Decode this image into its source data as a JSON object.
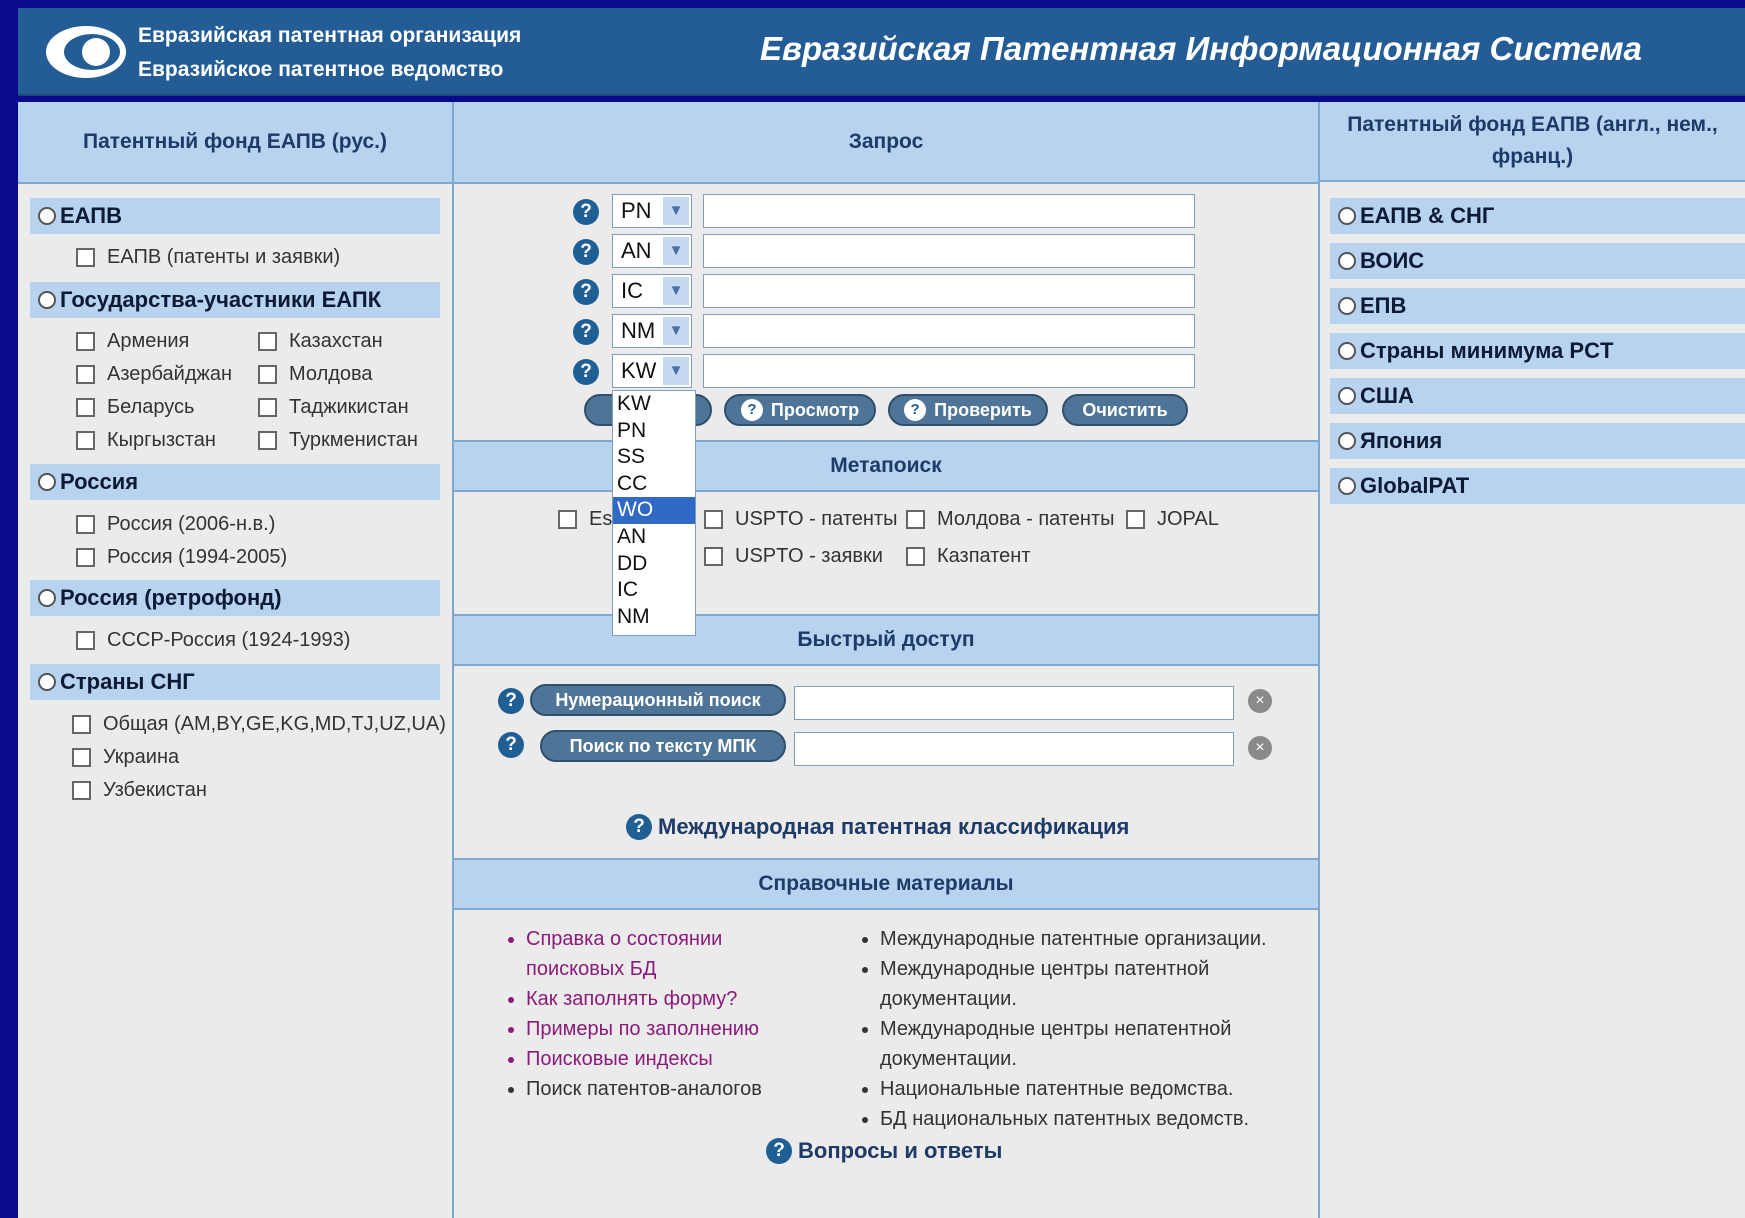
{
  "header": {
    "org_line1": "Евразийская патентная организация",
    "org_line2": "Евразийское патентное ведомство",
    "system_title": "Евразийская Патентная Информационная Система"
  },
  "left": {
    "heading": "Патентный фонд ЕАПВ (рус.)",
    "groups": [
      {
        "label": "ЕАПВ",
        "items": [
          "ЕАПВ (патенты и заявки)"
        ]
      },
      {
        "label": "Государства-участники ЕАПК",
        "items": [
          "Армения",
          "Казахстан",
          "Азербайджан",
          "Молдова",
          "Беларусь",
          "Таджикистан",
          "Кыргызстан",
          "Туркменистан"
        ]
      },
      {
        "label": "Россия",
        "items": [
          "Россия (2006-н.в.)",
          "Россия (1994-2005)"
        ]
      },
      {
        "label": "Россия (ретрофонд)",
        "items": [
          "СССР-Россия (1924-1993)"
        ]
      },
      {
        "label": "Страны СНГ",
        "items": [
          "Общая (AM,BY,GE,KG,MD,TJ,UZ,UA)",
          "Украина",
          "Узбекистан"
        ]
      }
    ]
  },
  "middle": {
    "heading": "Запрос",
    "query_fields": [
      "PN",
      "AN",
      "IC",
      "NM",
      "KW"
    ],
    "buttons": {
      "view": "Просмотр",
      "check": "Проверить",
      "clear": "Очистить"
    },
    "dropdown_options": [
      "KW",
      "PN",
      "SS",
      "CC",
      "WO",
      "AN",
      "DD",
      "IC",
      "NM"
    ],
    "dropdown_selected": "WO",
    "metasearch": {
      "heading": "Метапоиск",
      "items": [
        "Es",
        "USPTO - патенты",
        "Молдова - патенты",
        "JOPAL",
        "USPTO - заявки",
        "Казпатент"
      ]
    },
    "quick": {
      "heading": "Быстрый доступ",
      "number_search": "Нумерационный поиск",
      "ipc_text_search": "Поиск по тексту МПК",
      "ipc_link": "Международная патентная классификация"
    },
    "reference": {
      "heading": "Справочные материалы",
      "left_items": [
        {
          "text": "Справка о состоянии поисковых БД",
          "link": true
        },
        {
          "text": "Как заполнять форму?",
          "link": true
        },
        {
          "text": "Примеры по заполнению",
          "link": true
        },
        {
          "text": "Поисковые индексы",
          "link": true
        },
        {
          "text": "Поиск патентов-аналогов",
          "link": false
        }
      ],
      "right_items": [
        "Международные патентные организации.",
        "Международные центры патентной документации.",
        "Международные центры непатентной документации.",
        "Национальные патентные ведомства.",
        "БД национальных патентных ведомств."
      ],
      "faq": "Вопросы и ответы"
    }
  },
  "right": {
    "heading": "Патентный фонд ЕАПВ (англ., нем., франц.)",
    "options": [
      "ЕАПВ & СНГ",
      "ВОИС",
      "ЕПВ",
      "Страны минимума PCT",
      "США",
      "Япония",
      "GlobalPAT"
    ]
  },
  "icons": {
    "help": "question-icon",
    "clear": "clear-icon",
    "logo": "eye-logo"
  },
  "colors": {
    "header_bg": "#245d96",
    "section_bg": "#b7d3ef",
    "link": "#8b1a7a",
    "frame": "#0a0a8c"
  }
}
